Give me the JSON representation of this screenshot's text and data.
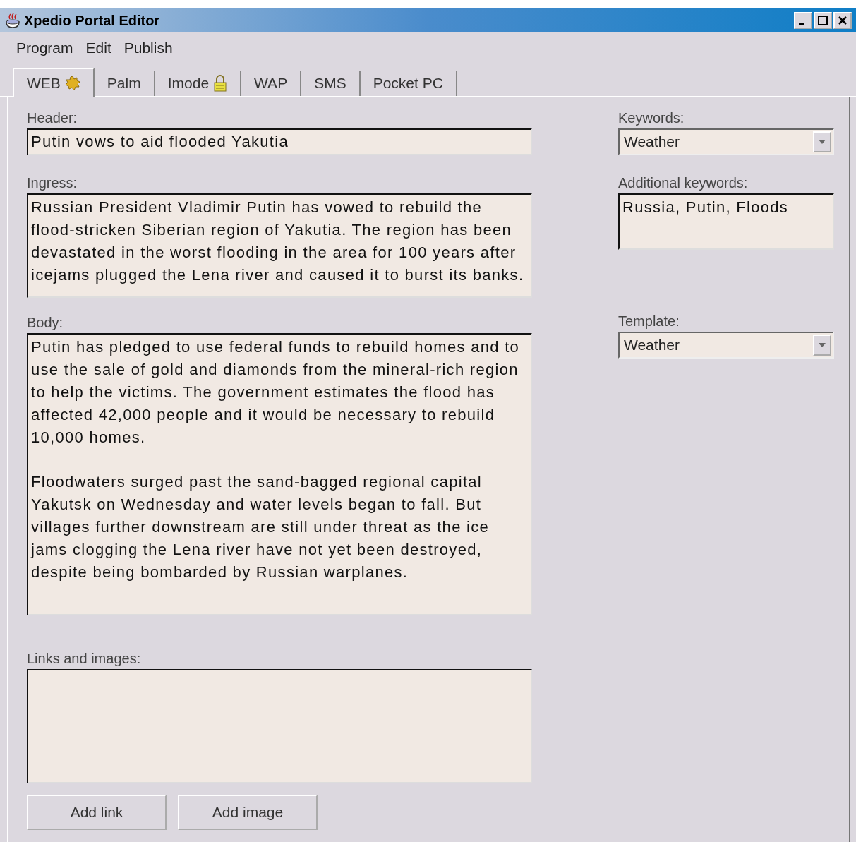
{
  "window": {
    "title": "Xpedio Portal Editor"
  },
  "menu": [
    "Program",
    "Edit",
    "Publish"
  ],
  "tabs": [
    {
      "label": "WEB",
      "selected": true,
      "kind": "starred"
    },
    {
      "label": "Palm",
      "selected": false,
      "kind": "plain"
    },
    {
      "label": "Imode",
      "selected": false,
      "kind": "locked"
    },
    {
      "label": "WAP",
      "selected": false,
      "kind": "plain"
    },
    {
      "label": "SMS",
      "selected": false,
      "kind": "plain"
    },
    {
      "label": "Pocket PC",
      "selected": false,
      "kind": "plain"
    }
  ],
  "header": {
    "label": "Header:",
    "value": "Putin vows to aid flooded Yakutia"
  },
  "ingress": {
    "label": "Ingress:",
    "value": "Russian President Vladimir Putin has vowed to rebuild the flood-stricken Siberian region of Yakutia. The region has been devastated in the worst flooding in the area for 100 years after icejams plugged the Lena river and caused it to burst its banks."
  },
  "body": {
    "label": "Body:",
    "value": "Putin has pledged to use federal funds to rebuild homes and to use the sale of gold and diamonds from the mineral-rich region to help the victims. The government estimates the flood has affected 42,000 people and it would be necessary to rebuild 10,000 homes.\n\nFloodwaters surged past the sand-bagged regional capital Yakutsk on Wednesday and water levels began to fall. But villages further downstream are still under threat as the ice jams clogging the Lena river have not yet been destroyed, despite being bombarded by Russian warplanes."
  },
  "links_and_images": {
    "label": "Links and images:"
  },
  "buttons": [
    "Add link",
    "Add image"
  ],
  "keywords": {
    "label": "Keywords:",
    "value": "Weather"
  },
  "additional_keywords": {
    "label": "Additional keywords:",
    "value": "Russia, Putin, Floods"
  },
  "template": {
    "label": "Template:",
    "value": "Weather"
  }
}
